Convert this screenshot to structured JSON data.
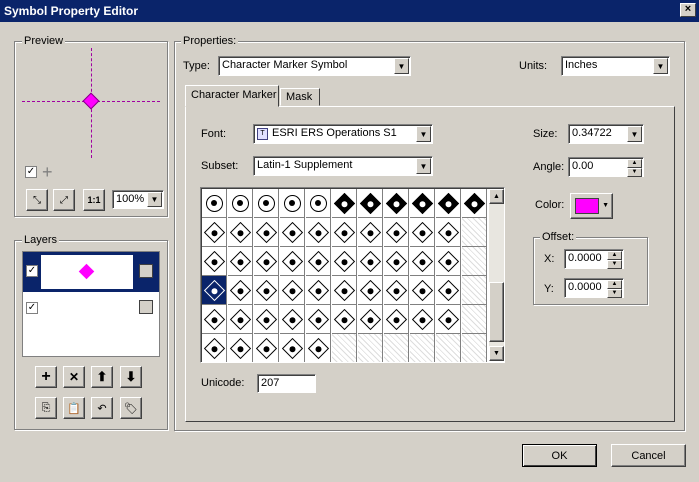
{
  "window": {
    "title": "Symbol Property Editor",
    "close_label": "×"
  },
  "preview": {
    "label": "Preview",
    "zoom": "100%"
  },
  "layers": {
    "label": "Layers"
  },
  "properties": {
    "label": "Properties:",
    "type_label": "Type:",
    "type_value": "Character Marker Symbol",
    "units_label": "Units:",
    "units_value": "Inches",
    "tabs": [
      "Character Marker",
      "Mask"
    ],
    "font_label": "Font:",
    "font_value": "ESRI ERS Operations S1",
    "subset_label": "Subset:",
    "subset_value": "Latin-1 Supplement",
    "unicode_label": "Unicode:",
    "unicode_value": "207",
    "size_label": "Size:",
    "size_value": "0.34722",
    "angle_label": "Angle:",
    "angle_value": "0.00",
    "color_label": "Color:",
    "color_value": "#ff00ff",
    "offset_label": "Offset:",
    "x_label": "X:",
    "x_value": "0.0000",
    "y_label": "Y:",
    "y_value": "0.0000"
  },
  "buttons": {
    "ok": "OK",
    "cancel": "Cancel"
  }
}
